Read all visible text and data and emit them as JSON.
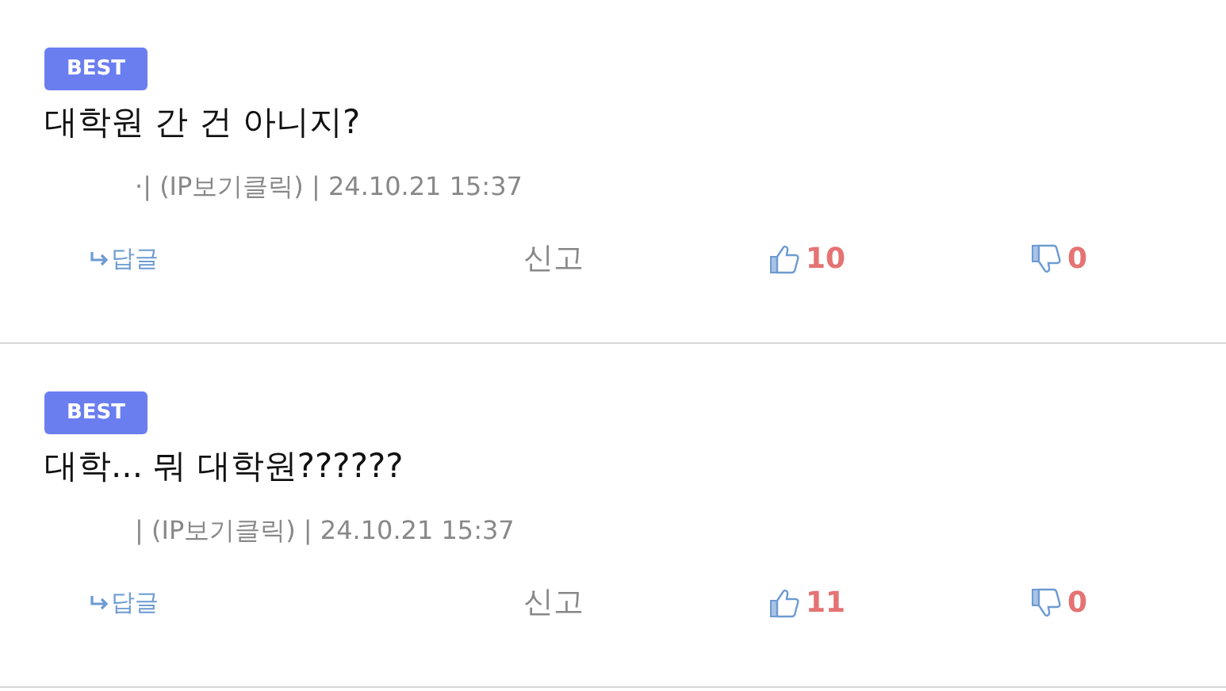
{
  "comments": [
    {
      "badge": "BEST",
      "text": "대학원 간 건 아니지?",
      "meta": "·| (IP보기클릭) | 24.10.21 15:37",
      "reply": "답글",
      "report": "신고",
      "likes": "10",
      "dislikes": "0"
    },
    {
      "badge": "BEST",
      "text": "대학... 뭐 대학원??????",
      "meta": "| (IP보기클릭) | 24.10.21 15:37",
      "reply": "답글",
      "report": "신고",
      "likes": "11",
      "dislikes": "0"
    }
  ]
}
